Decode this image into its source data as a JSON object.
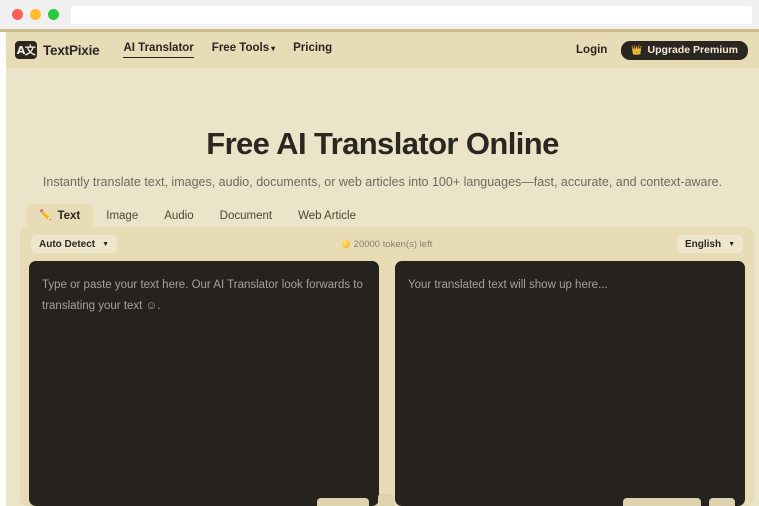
{
  "browser": {
    "traffic_lights": [
      "close",
      "minimize",
      "maximize"
    ],
    "url_value": "",
    "url_placeholder": ""
  },
  "header": {
    "logo_glyph": "A文",
    "brand_name": "TextPixie",
    "nav": [
      {
        "label": "AI Translator",
        "active": true,
        "caret": ""
      },
      {
        "label": "Free Tools",
        "active": false,
        "caret": "▾"
      },
      {
        "label": "Pricing",
        "active": false,
        "caret": ""
      }
    ],
    "login_label": "Login",
    "upgrade_label": "Upgrade Premium",
    "crown_icon": "👑"
  },
  "hero": {
    "title": "Free AI Translator Online",
    "subtitle": "Instantly translate text, images, audio, documents, or web articles into 100+ languages—fast, accurate, and context-aware."
  },
  "tabs": [
    {
      "label": "Text",
      "icon": "✏️",
      "active": true
    },
    {
      "label": "Image",
      "icon": "",
      "active": false
    },
    {
      "label": "Audio",
      "icon": "",
      "active": false
    },
    {
      "label": "Document",
      "icon": "",
      "active": false
    },
    {
      "label": "Web Article",
      "icon": "",
      "active": false
    }
  ],
  "toolbar": {
    "source_language": "Auto Detect",
    "target_language": "English",
    "caret": "▼",
    "token_text": "20000 token(s) left",
    "coin_icon": "coin-icon"
  },
  "panes": {
    "source": {
      "placeholder": "Type or paste your text here. Our AI Translator look forwards to translating your text ☺.",
      "value": ""
    },
    "target": {
      "placeholder": "Your translated text will show up here...",
      "value": ""
    }
  },
  "colors": {
    "page_bg": "#ece4c9",
    "header_bg": "#e7dcb6",
    "card_bg": "#e7dcb6",
    "pane_bg": "#26231f",
    "text_dark": "#2b2620",
    "text_muted": "#6e6a5e",
    "accent_gold": "#f5c733"
  }
}
